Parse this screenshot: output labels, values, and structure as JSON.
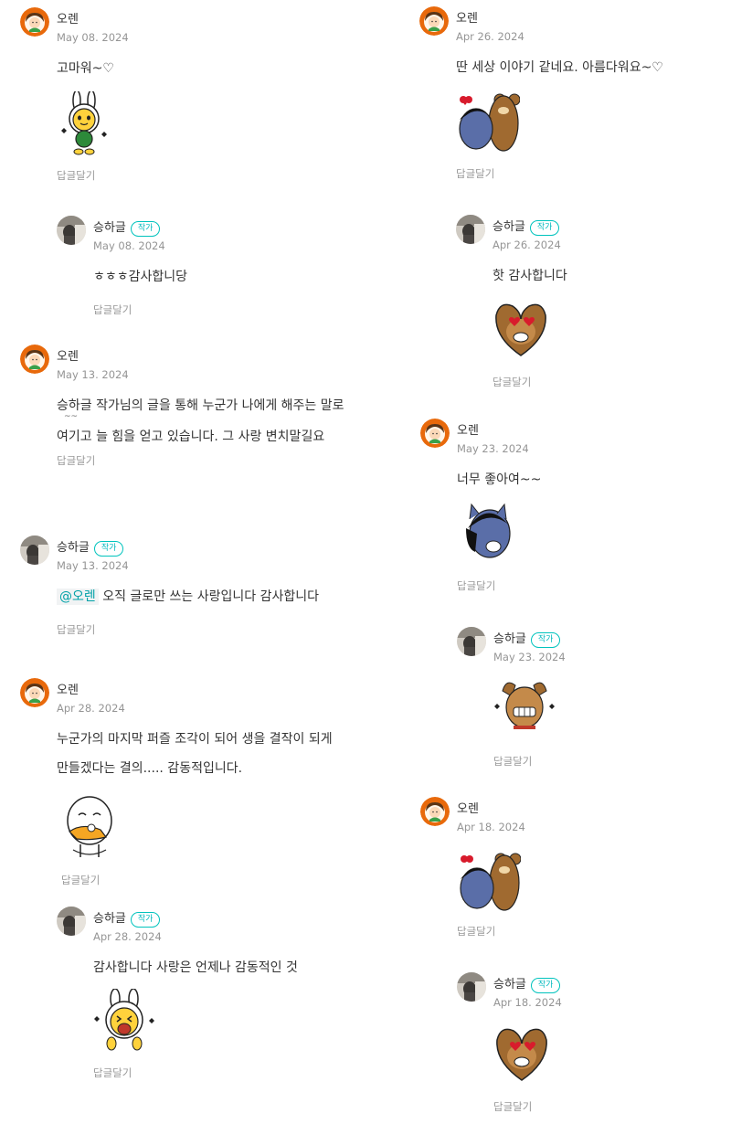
{
  "reply_label": "답글달기",
  "badge": "작가",
  "left": [
    {
      "author": "오렌",
      "date": "May 08. 2024",
      "lines": [
        "고마워~♡"
      ]
    },
    {
      "author": "승하글",
      "date": "May 08. 2024",
      "lines": [
        "ㅎㅎㅎ감사합니당"
      ]
    },
    {
      "author": "오렌",
      "date": "May 13. 2024",
      "lines": [
        "승하글 작가님의 글을 통해 누군가 나에게 해주는 말로",
        "~~",
        "여기고 늘 힘을 얻고 있습니다. 그 사랑 변치말길요"
      ]
    },
    {
      "author": "승하글",
      "date": "May 13. 2024",
      "mention": "@오렌",
      "lines": [
        "오직 글로만 쓰는 사랑입니다 감사합니다"
      ]
    },
    {
      "author": "오렌",
      "date": "Apr 28. 2024",
      "lines": [
        "누군가의 마지막 퍼즐 조각이 되어 생을 결작이 되게",
        "만들겠다는 결의..... 감동적입니다."
      ]
    },
    {
      "author": "승하글",
      "date": "Apr 28. 2024",
      "lines": [
        "감사합니다 사랑은 언제나 감동적인 것"
      ]
    }
  ],
  "right": [
    {
      "author": "오렌",
      "date": "Apr 26. 2024",
      "lines": [
        "딴 세상 이야기 같네요. 아름다워요~♡"
      ]
    },
    {
      "author": "승하글",
      "date": "Apr 26. 2024",
      "lines": [
        "핫 감사합니다"
      ]
    },
    {
      "author": "오렌",
      "date": "May 23. 2024",
      "lines": [
        "너무 좋아여~~"
      ]
    },
    {
      "author": "승하글",
      "date": "May 23. 2024",
      "lines": []
    },
    {
      "author": "오렌",
      "date": "Apr 18. 2024",
      "lines": []
    },
    {
      "author": "승하글",
      "date": "Apr 18. 2024",
      "lines": []
    }
  ]
}
